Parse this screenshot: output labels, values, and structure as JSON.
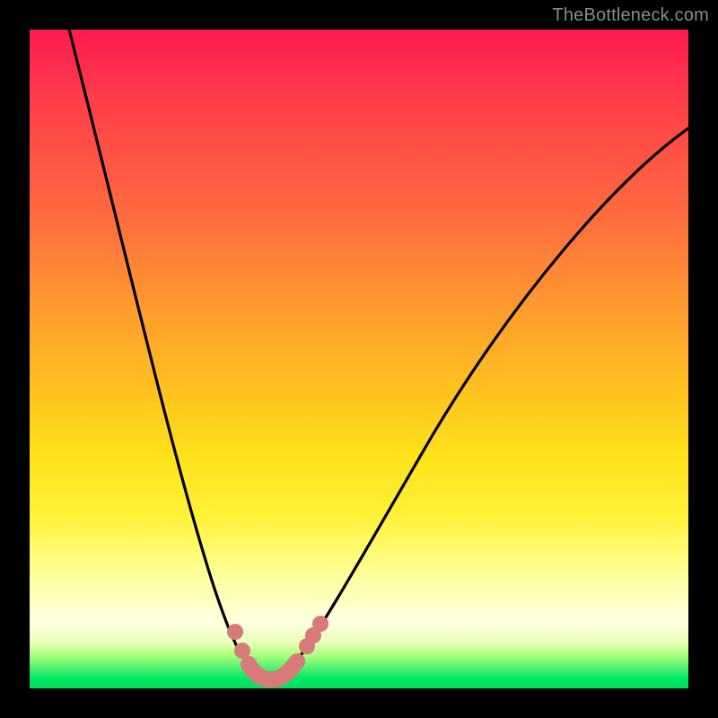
{
  "watermark": {
    "text": "TheBottleneck.com"
  },
  "chart_data": {
    "type": "line",
    "title": "",
    "xlabel": "",
    "ylabel": "",
    "xlim": [
      0,
      100
    ],
    "ylim": [
      0,
      100
    ],
    "grid": false,
    "legend_position": "none",
    "series": [
      {
        "name": "bottleneck-curve",
        "color": "#000000",
        "x": [
          6,
          10,
          14,
          18,
          22,
          24,
          26,
          28,
          29,
          30,
          31,
          32,
          33,
          34,
          35,
          36,
          37,
          38,
          39,
          40,
          42,
          45,
          50,
          55,
          60,
          65,
          70,
          75,
          80,
          85,
          90,
          95,
          100
        ],
        "y": [
          100,
          86,
          72,
          58,
          43,
          34,
          25,
          16,
          12,
          8,
          5,
          3,
          2,
          1.5,
          1.2,
          1.2,
          1.5,
          2,
          3,
          4,
          7,
          12,
          20,
          28,
          35,
          42,
          48,
          54,
          60,
          66,
          72,
          78,
          84
        ]
      },
      {
        "name": "highlight-dots",
        "type": "scatter",
        "color": "#d87a7a",
        "x": [
          29.5,
          30.5,
          31.5,
          32.5,
          33.5,
          34.5,
          35.5,
          36.5,
          38.0,
          39.5,
          40.5,
          41.5
        ],
        "y": [
          7.5,
          5.0,
          3.0,
          2.0,
          1.5,
          1.3,
          1.5,
          2.0,
          3.5,
          5.0,
          6.5,
          8.5
        ]
      }
    ],
    "annotations": []
  }
}
